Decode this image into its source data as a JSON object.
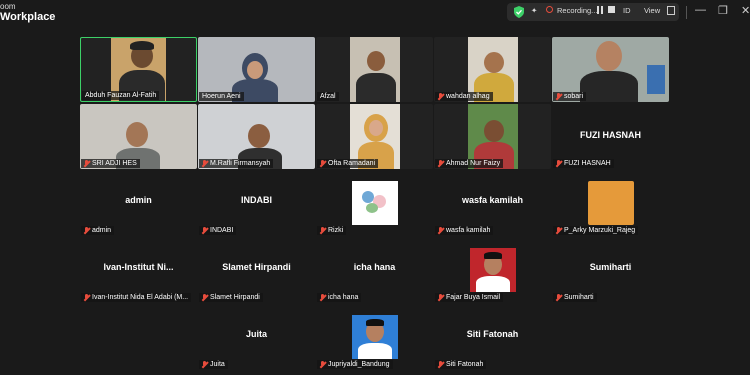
{
  "app": {
    "brand_line1": "oom",
    "brand_line2": "Workplace"
  },
  "toolbar": {
    "recording_label": "Recording...",
    "id_label": "ID",
    "view_label": "View"
  },
  "window_controls": {
    "minimize": "—",
    "maximize": "❐",
    "close": "✕"
  },
  "participants": [
    {
      "name": "Abduh Fauzan Al-Fatih",
      "muted": false,
      "video": true,
      "active": true
    },
    {
      "name": "Hoerun Aeni",
      "muted": false,
      "video": true
    },
    {
      "name": "Afzal",
      "muted": false,
      "video": true
    },
    {
      "name": "wahdan alhag",
      "muted": true,
      "video": true
    },
    {
      "name": "sobari",
      "muted": true,
      "video": true
    },
    {
      "name": "SRI ADJI HES",
      "muted": true,
      "video": true
    },
    {
      "name": "M.Rafli Firmansyah",
      "muted": true,
      "video": true
    },
    {
      "name": "Ofta Ramadani",
      "muted": true,
      "video": true
    },
    {
      "name": "Ahmad Nur Faizy",
      "muted": true,
      "video": true
    },
    {
      "name": "FUZI HASNAH",
      "muted": true,
      "video": false,
      "display": "FUZI HASNAH"
    },
    {
      "name": "admin",
      "muted": true,
      "video": false,
      "display": "admin"
    },
    {
      "name": "INDABI",
      "muted": true,
      "video": false,
      "display": "INDABI"
    },
    {
      "name": "Rizki",
      "muted": true,
      "video": false,
      "avatar": true
    },
    {
      "name": "wasfa kamilah",
      "muted": true,
      "video": false,
      "display": "wasfa kamilah"
    },
    {
      "name": "P_Arky Marzuki_Rajeg",
      "muted": true,
      "video": false,
      "avatar": true
    },
    {
      "name": "Ivan-Institut Nida El Adabi (M...",
      "muted": true,
      "video": false,
      "display": "Ivan-Institut  Ni..."
    },
    {
      "name": "Slamet Hirpandi",
      "muted": true,
      "video": false,
      "display": "Slamet Hirpandi"
    },
    {
      "name": "icha hana",
      "muted": true,
      "video": false,
      "display": "icha hana"
    },
    {
      "name": "Fajar Buya Ismail",
      "muted": true,
      "video": false,
      "avatar": true
    },
    {
      "name": "Sumiharti",
      "muted": true,
      "video": false,
      "display": "Sumiharti"
    },
    {
      "name": "Juita",
      "muted": true,
      "video": false,
      "display": "Juita"
    },
    {
      "name": "Jupriyaldi_Bandung",
      "muted": true,
      "video": false,
      "avatar": true
    },
    {
      "name": "Siti Fatonah",
      "muted": true,
      "video": false,
      "display": "Siti Fatonah"
    }
  ],
  "colors": {
    "active_border": "#3dd068",
    "muted_icon": "#e74c3c",
    "background": "#1a1a1a"
  }
}
